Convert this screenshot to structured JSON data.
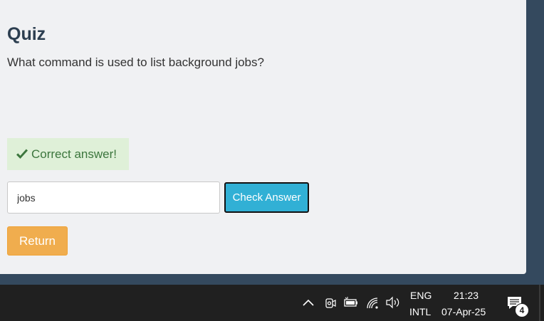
{
  "quiz": {
    "title": "Quiz",
    "question": "What command is used to list background jobs?",
    "feedback": "Correct answer!",
    "answer_value": "jobs",
    "check_label": "Check Answer",
    "return_label": "Return"
  },
  "taskbar": {
    "language_top": "ENG",
    "language_bottom": "INTL",
    "time": "21:23",
    "date": "07-Apr-25",
    "notification_count": "4",
    "icons": [
      "chevron-up-icon",
      "meet-now-icon",
      "battery-icon",
      "wifi-icon",
      "volume-icon",
      "notification-icon"
    ]
  },
  "colors": {
    "page_background": "#34495e",
    "panel": "#f0f1f3",
    "success_bg": "#dff0d8",
    "success_text": "#3c763d",
    "info_button": "#31b0d5",
    "warning_button": "#f0ad4e",
    "taskbar": "#202020"
  }
}
